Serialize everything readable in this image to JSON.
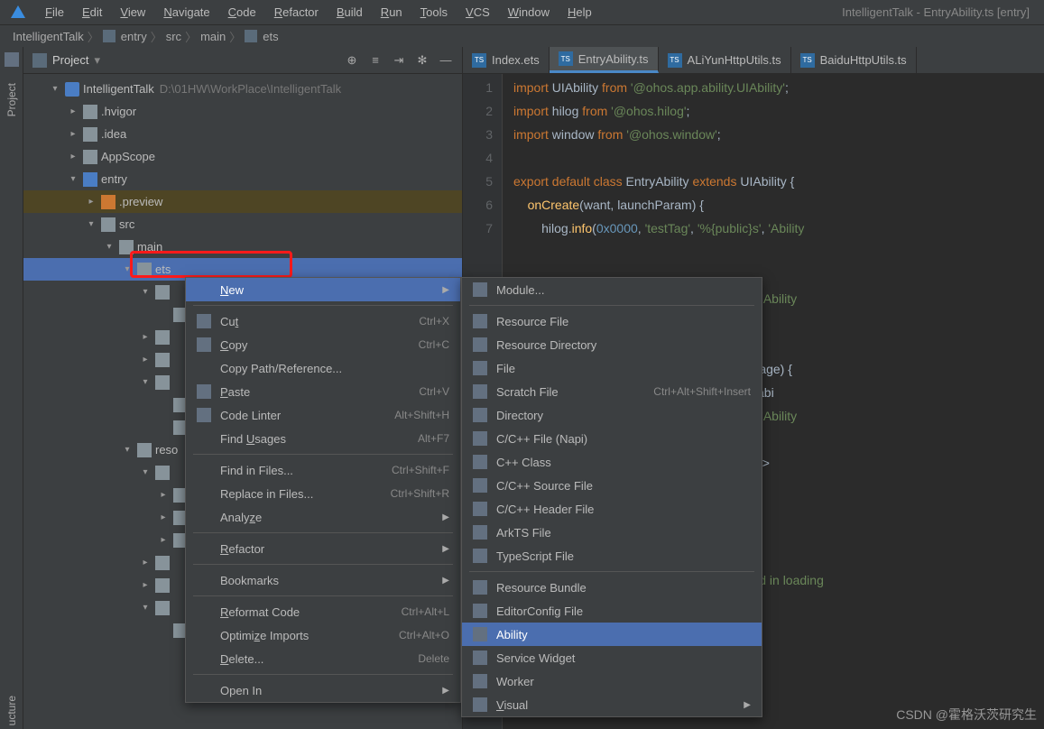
{
  "window_title": "IntelligentTalk - EntryAbility.ts [entry]",
  "menubar": [
    "File",
    "Edit",
    "View",
    "Navigate",
    "Code",
    "Refactor",
    "Build",
    "Run",
    "Tools",
    "VCS",
    "Window",
    "Help"
  ],
  "breadcrumb": [
    "IntelligentTalk",
    "entry",
    "src",
    "main",
    "ets"
  ],
  "panel": {
    "mode": "Project"
  },
  "tree": {
    "root": {
      "name": "IntelligentTalk",
      "path": "D:\\01HW\\WorkPlace\\IntelligentTalk"
    },
    "items": [
      {
        "name": ".hvigor",
        "indent": 2,
        "ch": "▸"
      },
      {
        "name": ".idea",
        "indent": 2,
        "ch": "▸"
      },
      {
        "name": "AppScope",
        "indent": 2,
        "ch": "▸"
      },
      {
        "name": "entry",
        "indent": 2,
        "ch": "▾",
        "blue": true
      },
      {
        "name": ".preview",
        "indent": 3,
        "ch": "▸",
        "orange": true,
        "hl": true
      },
      {
        "name": "src",
        "indent": 3,
        "ch": "▾"
      },
      {
        "name": "main",
        "indent": 4,
        "ch": "▾"
      },
      {
        "name": "ets",
        "indent": 5,
        "ch": "▾",
        "selected": true
      }
    ],
    "partial": [
      {
        "indent": 6,
        "ch": "▾"
      },
      {
        "indent": 7,
        "ch": ""
      },
      {
        "indent": 6,
        "ch": "▸"
      },
      {
        "indent": 6,
        "ch": "▸"
      },
      {
        "indent": 6,
        "ch": "▾"
      },
      {
        "indent": 7,
        "ch": ""
      },
      {
        "indent": 7,
        "ch": ""
      },
      {
        "indent": 5,
        "ch": "▾",
        "label": "reso"
      },
      {
        "indent": 6,
        "ch": "▾"
      },
      {
        "indent": 7,
        "ch": "▸"
      },
      {
        "indent": 7,
        "ch": "▸"
      },
      {
        "indent": 7,
        "ch": "▸"
      },
      {
        "indent": 6,
        "ch": "▸"
      },
      {
        "indent": 6,
        "ch": "▸"
      },
      {
        "indent": 6,
        "ch": "▾"
      },
      {
        "indent": 7,
        "ch": ""
      }
    ]
  },
  "tabs": [
    {
      "name": "Index.ets"
    },
    {
      "name": "EntryAbility.ts",
      "active": true
    },
    {
      "name": "ALiYunHttpUtils.ts"
    },
    {
      "name": "BaiduHttpUtils.ts"
    }
  ],
  "code_lines": [
    "1",
    "2",
    "3",
    "4",
    "5",
    "6",
    "7"
  ],
  "ctx1": [
    {
      "label": "New",
      "sel": true,
      "arrow": true,
      "u": "N"
    },
    {
      "sep": true
    },
    {
      "label": "Cut",
      "shortcut": "Ctrl+X",
      "icon": "cut",
      "u": "t"
    },
    {
      "label": "Copy",
      "shortcut": "Ctrl+C",
      "icon": "copy",
      "u": "C"
    },
    {
      "label": "Copy Path/Reference..."
    },
    {
      "label": "Paste",
      "shortcut": "Ctrl+V",
      "icon": "paste",
      "u": "P"
    },
    {
      "label": "Code Linter",
      "shortcut": "Alt+Shift+H",
      "icon": "linter"
    },
    {
      "label": "Find Usages",
      "shortcut": "Alt+F7",
      "u": "U"
    },
    {
      "sep": true
    },
    {
      "label": "Find in Files...",
      "shortcut": "Ctrl+Shift+F"
    },
    {
      "label": "Replace in Files...",
      "shortcut": "Ctrl+Shift+R"
    },
    {
      "label": "Analyze",
      "arrow": true,
      "u": "z"
    },
    {
      "sep": true
    },
    {
      "label": "Refactor",
      "arrow": true,
      "u": "R"
    },
    {
      "sep": true
    },
    {
      "label": "Bookmarks",
      "arrow": true
    },
    {
      "sep": true
    },
    {
      "label": "Reformat Code",
      "shortcut": "Ctrl+Alt+L",
      "u": "R"
    },
    {
      "label": "Optimize Imports",
      "shortcut": "Ctrl+Alt+O",
      "u": "z"
    },
    {
      "label": "Delete...",
      "shortcut": "Delete",
      "u": "D"
    },
    {
      "sep": true
    },
    {
      "label": "Open In",
      "arrow": true
    }
  ],
  "ctx2": [
    {
      "label": "Module...",
      "icon": "module"
    },
    {
      "sep": true
    },
    {
      "label": "Resource File",
      "icon": "folder"
    },
    {
      "label": "Resource Directory",
      "icon": "folder"
    },
    {
      "label": "File",
      "icon": "file"
    },
    {
      "label": "Scratch File",
      "shortcut": "Ctrl+Alt+Shift+Insert",
      "icon": "file"
    },
    {
      "label": "Directory",
      "icon": "folder"
    },
    {
      "label": "C/C++ File (Napi)",
      "icon": "c"
    },
    {
      "label": "C++ Class",
      "icon": "c"
    },
    {
      "label": "C/C++ Source File",
      "icon": "c"
    },
    {
      "label": "C/C++ Header File",
      "icon": "c"
    },
    {
      "label": "ArkTS File",
      "icon": "ts"
    },
    {
      "label": "TypeScript File",
      "icon": "ts"
    },
    {
      "sep": true
    },
    {
      "label": "Resource Bundle",
      "icon": "bundle"
    },
    {
      "label": "EditorConfig File",
      "icon": "config"
    },
    {
      "label": "Ability",
      "icon": "ability",
      "sel": true
    },
    {
      "label": "Service Widget",
      "icon": "widget"
    },
    {
      "label": "Worker",
      "icon": "worker"
    },
    {
      "label": "Visual",
      "arrow": true,
      "icon": "visual",
      "u": "V"
    }
  ],
  "watermark": "CSDN @霍格沃茨研究生"
}
